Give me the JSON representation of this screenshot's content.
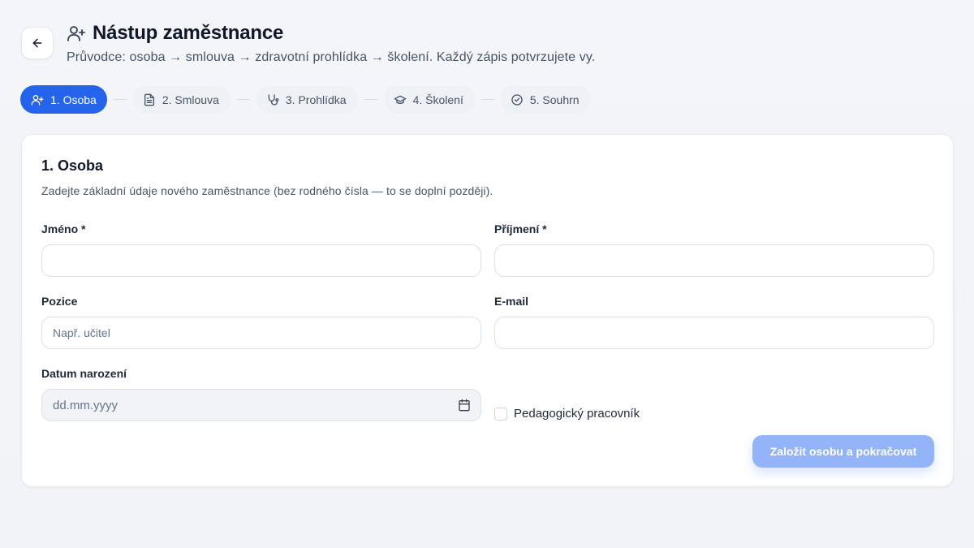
{
  "header": {
    "title": "Nástup zaměstnance",
    "subtitle": "Průvodce: osoba → smlouva → zdravotní prohlídka → školení. Každý zápis potvrzujete vy.",
    "back_icon": "arrow-left-icon",
    "title_icon": "user-plus-icon"
  },
  "steps": [
    {
      "label": "1. Osoba",
      "icon": "user-plus-icon",
      "active": true
    },
    {
      "label": "2. Smlouva",
      "icon": "file-text-icon",
      "active": false
    },
    {
      "label": "3. Prohlídka",
      "icon": "stethoscope-icon",
      "active": false
    },
    {
      "label": "4. Školení",
      "icon": "graduation-cap-icon",
      "active": false
    },
    {
      "label": "5. Souhrn",
      "icon": "check-circle-icon",
      "active": false
    }
  ],
  "form": {
    "title": "1. Osoba",
    "description": "Zadejte základní údaje nového zaměstnance (bez rodného čísla — to se doplní později).",
    "first_name": {
      "label": "Jméno *",
      "value": "",
      "placeholder": ""
    },
    "last_name": {
      "label": "Příjmení *",
      "value": "",
      "placeholder": ""
    },
    "position": {
      "label": "Pozice",
      "value": "",
      "placeholder": "Např. učitel"
    },
    "email": {
      "label": "E-mail",
      "value": "",
      "placeholder": ""
    },
    "birth_date": {
      "label": "Datum narození",
      "placeholder": "dd.mm.yyyy",
      "icon": "calendar-icon"
    },
    "pedagogical": {
      "label": "Pedagogický pracovník",
      "checked": false
    },
    "submit_label": "Založit osobu a pokračovat"
  },
  "colors": {
    "accent": "#2563eb",
    "submit_disabled": "#93b4f8",
    "background": "#f3f5f8"
  }
}
